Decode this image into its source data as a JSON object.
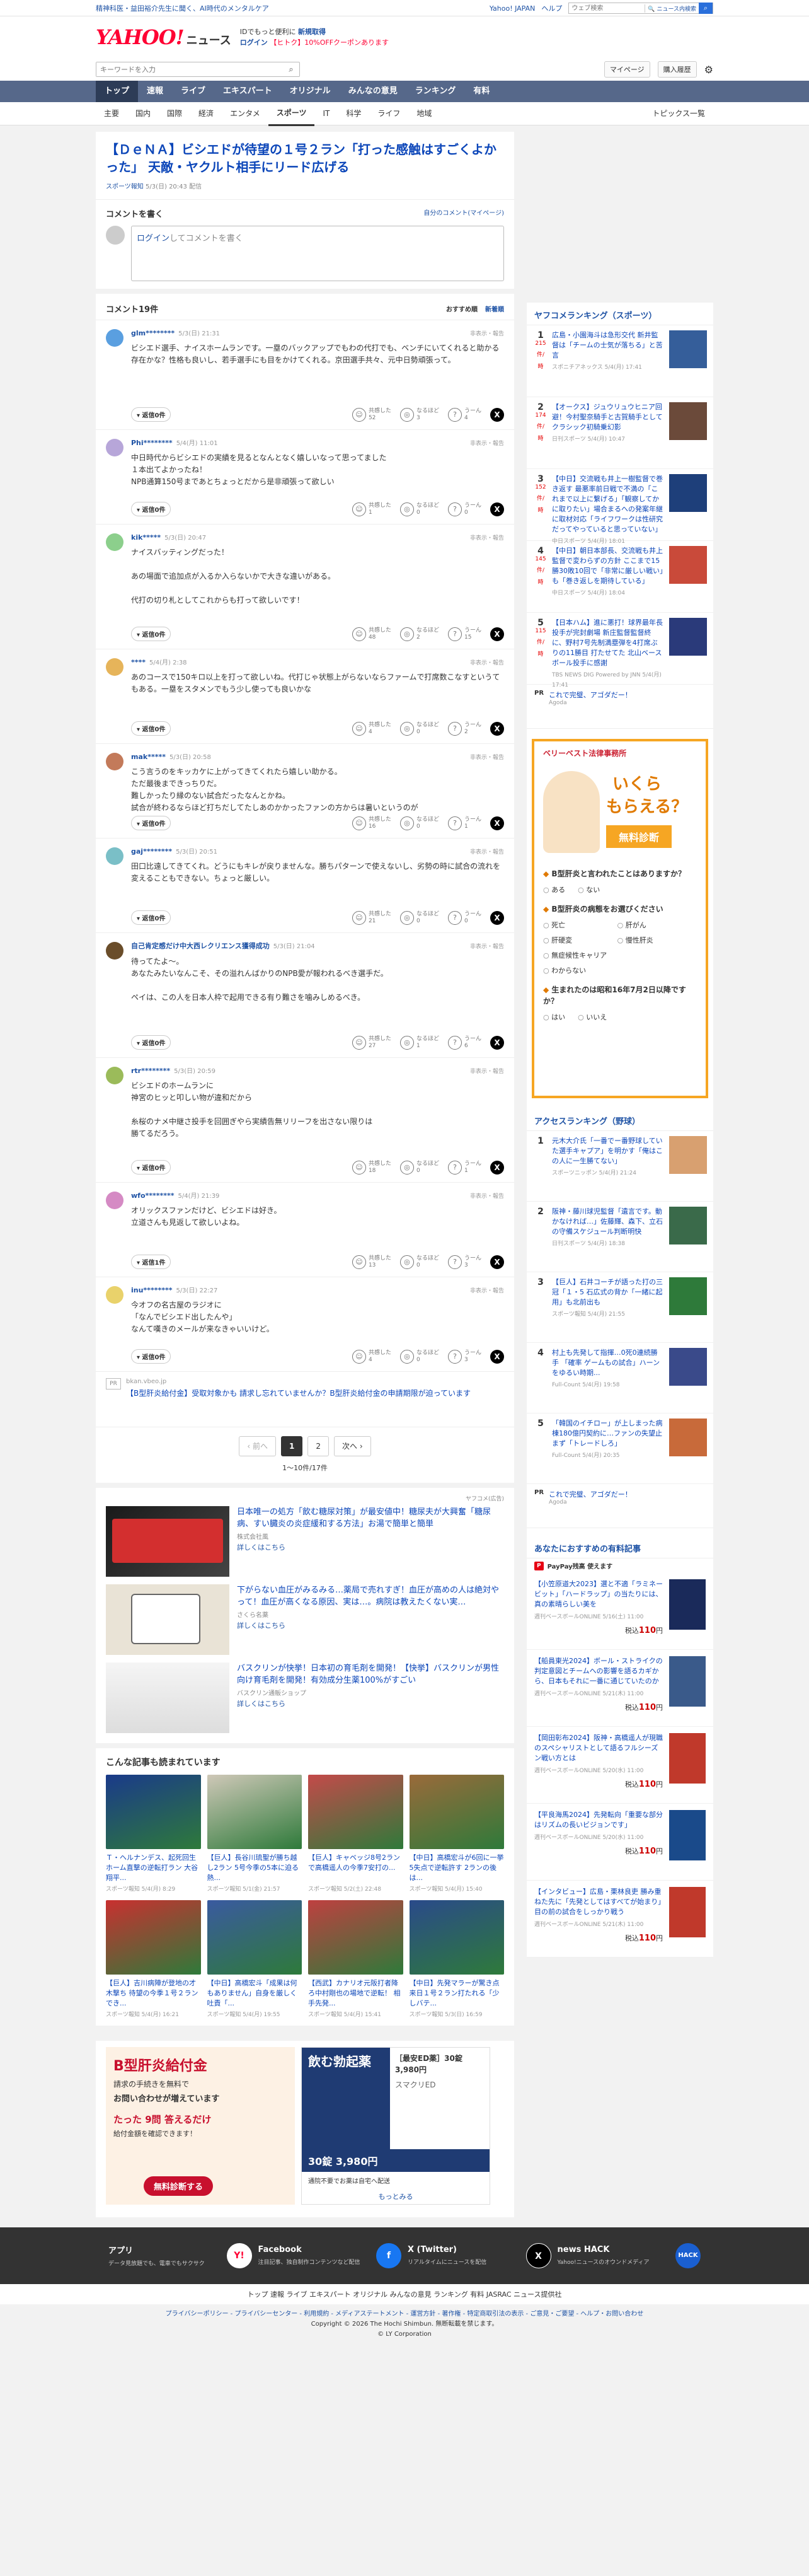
{
  "top": {
    "links": [
      "精神科医・益田裕介先生に聞く、AI時代のメンタルケア"
    ],
    "yahoo_japan": "Yahoo! JAPAN",
    "help": "ヘルプ",
    "search_placeholder": "ウェブ検索",
    "search_all": "🔍 ニュース内検索"
  },
  "header": {
    "logo": "YAHOO!",
    "logo_sub": "ニュース",
    "logo_jp": "JAPAN",
    "promo1": "IDでもっと便利に",
    "promo1b": "新規取得",
    "promo2": "ログイン",
    "promo2b": "【ヒトク】10%OFFクーポンあります"
  },
  "subbar": {
    "kw_placeholder": "キーワードを入力",
    "mypage": "マイページ",
    "subscribe": "購入履歴",
    "gear": "⚙"
  },
  "nav": [
    "トップ",
    "速報",
    "ライブ",
    "エキスパート",
    "オリジナル",
    "みんなの意見",
    "ランキング",
    "有料"
  ],
  "subnav": [
    "主要",
    "国内",
    "国際",
    "経済",
    "エンタメ",
    "スポーツ",
    "IT",
    "科学",
    "ライフ",
    "地域"
  ],
  "subnav_right": "トピックス一覧",
  "article": {
    "title": "【ＤｅＮＡ】ビシエドが待望の１号２ラン「打った感触はすごくよかった」 天敵・ヤクルト相手にリード広げる",
    "source": "スポーツ報知",
    "date": "5/3(日) 20:43 配信"
  },
  "compose": {
    "title": "コメントを書く",
    "policy": "自分のコメント(マイページ)",
    "login": "ログイン",
    "placeholder": "してコメントを書く"
  },
  "clist": {
    "count": "コメント19件",
    "sort1": "おすすめ順",
    "sort2": "新着順"
  },
  "comments": [
    {
      "user": "glm********",
      "time": "5/3(日) 21:31",
      "body": "ビシエド選手、ナイスホームランです。一塁のバックアップでもわの代打でも、ベンチにいてくれると助かる存在かな？性格も良いし、若手選手にも目をかけてくれる。京田選手共々、元中日勢頑張って。",
      "r1": "52",
      "r2": "3",
      "r3": "4",
      "reply": "返信0件"
    },
    {
      "user": "Phi********",
      "time": "5/4(月) 11:01",
      "body": "中日時代からビシエドの実績を見るとなんとなく嬉しいなって思ってました\n１本出てよかったね！\nNPB通算150号まであとちょっとだから是非頑張って欲しい",
      "r1": "1",
      "r2": "0",
      "r3": "0",
      "reply": "返信0件"
    },
    {
      "user": "kik*****",
      "time": "5/3(日) 20:47",
      "body": "ナイスバッティングだった！\n\nあの場面で追加点が入るか入らないかで大きな違いがある。\n\n代打の切り札としてこれからも打って欲しいです！",
      "r1": "48",
      "r2": "2",
      "r3": "15",
      "reply": "返信0件"
    },
    {
      "user": "****",
      "time": "5/4(月) 2:38",
      "body": "あのコースで150キロ以上を打って欲しいね。代打じゃ状態上がらないならファームで打席数こなすというてもある。一塁をスタメンでもう少し使っても良いかな",
      "r1": "4",
      "r2": "0",
      "r3": "2",
      "reply": "返信0件"
    },
    {
      "user": "mak*****",
      "time": "5/3(日) 20:58",
      "body": "こう言うのをキッカケに上がってきてくれたら嬉しい助かる。\nただ最後まできっちりだ。\n難しかったり縁のない試合だったなんとかね。\n試合が終わるならほど打ちだしてたしあのかかったファンの方からは暑いというのが",
      "r1": "16",
      "r2": "0",
      "r3": "1",
      "reply": "返信0件"
    },
    {
      "user": "gaj********",
      "time": "5/3(日) 20:51",
      "body": "田口比遠してきてくれ。どうにもキレが戻りませんな。勝ちパターンで使えないし、劣勢の時に試合の流れを変えることもできない。ちょっと厳しい。",
      "r1": "21",
      "r2": "0",
      "r3": "0",
      "reply": "返信0件"
    },
    {
      "user": "自己肯定感だけ中大西レクリエンス獲得成功",
      "time": "5/3(日) 21:04",
      "body": "待ってたよ〜。\nあなたみたいなんこそ、その溢れんばかりのNPB愛が報われるべき選手だ。\n\nペイは、この人を日本人枠で起用できる有り難さを噛みしめるべき。",
      "r1": "27",
      "r2": "1",
      "r3": "6",
      "reply": "返信0件"
    },
    {
      "user": "rtr********",
      "time": "5/3(日) 20:59",
      "body": "ビシエドのホームランに\n神宮のヒッと叩しい物が違和だから\n\n糸桜のナメ中継さ投手を回囲ぎやら実績告無リリーフを出さない限りは\n勝てるだろう。",
      "r1": "18",
      "r2": "0",
      "r3": "1",
      "reply": "返信0件"
    },
    {
      "user": "wfo********",
      "time": "5/4(月) 21:39",
      "body": "オリックスファンだけど、ビシエドは好き。\n立道さんも見返して欲しいよね。",
      "r1": "13",
      "r2": "0",
      "r3": "3",
      "reply": "返信1件"
    },
    {
      "user": "inu********",
      "time": "5/3(日) 22:27",
      "body": "今オフの名古屋のラジオに\n「なんでビシエド出したんや」\nなんて嘆きのメールが来なきゃいいけど。",
      "r1": "4",
      "r2": "0",
      "r3": "3",
      "reply": "返信0件"
    }
  ],
  "comment_labels": {
    "report": "非表示・報告",
    "l1": "共感した",
    "l2": "なるほど",
    "l3": "うーん"
  },
  "pr1": {
    "label": "PR",
    "src": "bkan.vbeo.jp",
    "title": "【B型肝炎給付金】受取対象かも 請求し忘れていませんか？B型肝炎給付金の申請期限が迫っています"
  },
  "pager": {
    "prev": "前へ",
    "p1": "1",
    "p2": "2",
    "next": "次へ",
    "range": "1〜10件/17件"
  },
  "ads": {
    "tag": "ヤフコメ(広告)",
    "items": [
      {
        "head": "日本唯一の処方「飲む糖尿対策」が最安値中！糖尿夫が大興奮「糖尿病、すい臓炎の炎症緩和する方法」お湯で簡単と簡単",
        "src": "株式会社風",
        "detail": "詳しくはこちら"
      },
      {
        "head": "下がらない血圧がみるみる…薬局で売れすぎ！血圧が高めの人は絶対やって！血圧が高くなる原因、実は…。病院は教えたくない実…",
        "src": "さくら名薬",
        "detail": "詳しくはこちら"
      },
      {
        "head": "バスクリンが快挙！日本初の育毛剤を開発！【快挙】バスクリンが男性向け育毛剤を開発！有効成分生薬100%がすごい",
        "src": "バスクリン通販ショップ",
        "detail": "詳しくはこちら"
      }
    ]
  },
  "more": {
    "title": "こんな記事も読まれています",
    "items": [
      {
        "t": "Ｔ・ヘルナンデス、起死回生ホーム直撃の逆転打ラン 大谷翔平...",
        "s": "スポーツ報知 5/4(月) 8:29"
      },
      {
        "t": "【巨人】長谷川琉聖が勝ち越し2ラン 5号今季の5本に迫る熱...",
        "s": "スポーツ報知 5/1(金) 21:57"
      },
      {
        "t": "【巨人】キャベッジ8号2ランで高橋遥人の今季7安打の...",
        "s": "スポーツ報知 5/2(土) 22:48"
      },
      {
        "t": "【中日】高橋宏斗が6回に一挙5失点で逆転許す 2ランの後は...",
        "s": "スポーツ報知 5/4(月) 15:40"
      },
      {
        "t": "【巨人】吉川病陣が登地の才木撃ち 待望の今季１号２ランでき...",
        "s": "スポーツ報知 5/4(月) 16:21"
      },
      {
        "t": "【中日】高橋宏斗「成果は何もありません」自身を厳しく吐責「...",
        "s": "スポーツ報知 5/4(月) 19:55"
      },
      {
        "t": "【西武】カナリオ元阪打者降ろ中村剛也の場地で逆転！ 相手先発...",
        "s": "スポーツ報知 5/4(月) 15:41"
      },
      {
        "t": "【中日】先発マラーが驚き点来日１号２ラン打たれる「少しバテ...",
        "s": "スポーツ報知 5/3(日) 16:59"
      }
    ]
  },
  "bigad": {
    "h1": "B型肝炎給付金",
    "h2": "請求の手続きを無料で",
    "h3": "お問い合わせが増えています",
    "h4": "たった 9問 答えるだけ",
    "h5": "給付金額を確認できます！",
    "h6": "無料診断する",
    "r1": "飲む勃起薬",
    "r2": "［最安ED薬］30錠 3,980円",
    "r3": "スマクリED",
    "r4": "30錠 3,980円",
    "r5": "通院不要でお薬は自宅へ配送",
    "r6": "もっとみる"
  },
  "footer": {
    "items": [
      {
        "h": "アプリ",
        "s": "データ見放題でも、電車でもサクサク"
      },
      {
        "h": "Facebook",
        "s": "注目記事、独自制作コンテンツなど配信"
      },
      {
        "h": "X (Twitter)",
        "s": "リアルタイムにニュースを配信"
      },
      {
        "h": "news HACK",
        "s": "Yahoo!ニュースのオウンドメディア"
      }
    ],
    "links": "トップ 速報 ライブ エキスパート オリジナル みんなの意見 ランキング 有料 JASRAC ニュース提供社",
    "policy": "プライバシーポリシー - プライバシーセンター - 利用規約 - メディアステートメント - 運営方針 - 著作権 - 特定商取引法の表示 - ご意見・ご要望 - ヘルプ・お問い合わせ",
    "copy1": "Copyright © 2026 The Hochi Shimbun. 無断転載を禁じます。",
    "copy2": "© LY Corporation"
  },
  "side": {
    "rank_title": "ヤフコメランキング（スポーツ）",
    "rank": [
      {
        "n": "1",
        "c": "215",
        "u": "件/時",
        "t": "広島・小園海斗は急形交代 新井監督は「チームの士気が落ちる」と苦言",
        "s": "スポニチアネックス 5/4(月) 17:41"
      },
      {
        "n": "2",
        "c": "174",
        "u": "件/時",
        "t": "【オークス】ジュウリュウヒニア回避！今村聖奈騎手と古賀騎手としてクラシック初騎乗幻影",
        "s": "日刊スポーツ 5/4(月) 10:47"
      },
      {
        "n": "3",
        "c": "152",
        "u": "件/時",
        "t": "【中日】交流戦も井上一樹監督で巻き返す 最悪率前日戦で不満の「これまで以上に繋げる」「観察してかに取りたい」場合まるへの発案年継に取材対応「ライフワークは性研究だってやっていると思っていない」",
        "s": "中日スポーツ 5/4(月) 18:01"
      },
      {
        "n": "4",
        "c": "145",
        "u": "件/時",
        "t": "【中日】朝日本部長、交流戦も井上監督で変わらずの方針 ここまで15勝30敗10回で「非常に厳しい戦い」も「巻き返しを期待している」",
        "s": "中日スポーツ 5/4(月) 18:04"
      },
      {
        "n": "5",
        "c": "115",
        "u": "件/時",
        "t": "【日本ハム】進に悪打！球界最年長投手が完封劇場 新庄監督監督終に、野村7号先制満塁弾を4打席ぶりの11勝目 打たせてた 北山ベースボール投手に感謝",
        "s": "TBS NEWS DIG Powered by JNN 5/4(月) 17:41"
      }
    ],
    "sidepr1": {
      "lbl": "PR",
      "t": "これで完璧、アゴダだー！",
      "s": "Agoda"
    },
    "quiz": {
      "hd": "ベリーベスト法律事務所",
      "big1": "いくら",
      "big2": "もらえる？",
      "big3": "無料診断",
      "q1": "B型肝炎と言われたことはありますか？",
      "o1": [
        "ある",
        "ない"
      ],
      "q2": "B型肝炎の病態をお選びください",
      "o2": [
        "死亡",
        "肝がん",
        "肝硬変",
        "慢性肝炎",
        "無症候性キャリア",
        "わからない"
      ],
      "q3": "生まれたのは昭和16年7月2日以降ですか？",
      "o3": [
        "はい",
        "いいえ"
      ]
    },
    "access_title": "アクセスランキング（野球）",
    "access": [
      {
        "n": "1",
        "t": "元木大介氏「一番でー番野球していた選手キャプア」を明かす「俺はこの人に一生勝てない」",
        "s": "スポーツニッポン 5/4(月) 21:24"
      },
      {
        "n": "2",
        "t": "阪神・藤川球児監督「遺言です。動かなければ…」佐藤輝、森下、立石の守備スケジュール判断明快",
        "s": "日刊スポーツ 5/4(月) 18:38"
      },
      {
        "n": "3",
        "t": "【巨人】石井コーチが語った打の三冠「１・5 石広式の背か「一緒に起用」も北前出も",
        "s": "スポーツ報知 5/4(月) 21:55"
      },
      {
        "n": "4",
        "t": "村上も先発して指揮…0死0連続勝手 「確率 ゲームもの試合」ハーンをゆるい時期...",
        "s": "Full-Count 5/4(月) 19:58"
      },
      {
        "n": "5",
        "t": "「韓国のイチロー」が上しまった病棟180億円契約に…ファンの失望止まず「トレードしろ」",
        "s": "Full-Count 5/4(月) 20:35"
      }
    ],
    "sidepr2": {
      "lbl": "PR",
      "t": "これで完璧、アゴダだー！",
      "s": "Agoda"
    },
    "books_title": "あなたにおすすめの有料記事",
    "pp": "PayPay残高 使えます",
    "books": [
      {
        "t": "【小笠原道大2023】選と不適「ラミネービット」「ハードラップ」の当たりには、真の素晴らしい美を",
        "s": "週刊ベースボールONLINE 5/16(土) 11:00",
        "p": "110"
      },
      {
        "t": "【船員東光2024】ボール・ストライクの判定意図とチームへの影響を語るカギから、日本もそれに一番に通じていたのか",
        "s": "週刊ベースボールONLINE 5/21(木) 11:00",
        "p": "110"
      },
      {
        "t": "【岡田彰布2024】阪神・高橋遥人が現職のスペシャリストとして語るフルシーズン戦い方とは",
        "s": "週刊ベースボールONLINE 5/20(水) 11:00",
        "p": "110"
      },
      {
        "t": "【平良海馬2024】先発転向「重要な部分はリズムの長いビジョンです」",
        "s": "週刊ベースボールONLINE 5/20(水) 11:00",
        "p": "110"
      },
      {
        "t": "【インタビュー】広島・栗林良吏 勝み重ねた先に「先発としてはすべてが始まり」目の前の試合をしっかり戦う",
        "s": "週刊ベースボールONLINE 5/21(木) 11:00",
        "p": "110"
      }
    ],
    "yen": "税込"
  }
}
